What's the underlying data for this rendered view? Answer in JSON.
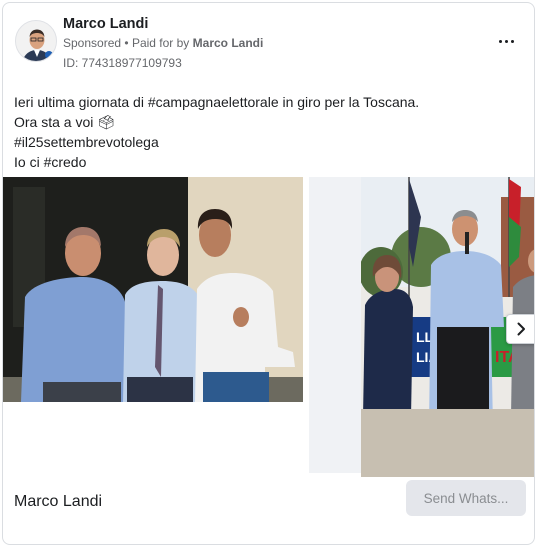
{
  "header": {
    "page_name": "Marco Landi",
    "sponsored_label": "Sponsored",
    "separator": "•",
    "paid_for_prefix": "Paid for by",
    "paid_for_name": "Marco Landi",
    "ad_id": "ID: 774318977109793",
    "more_icon": "more-options-icon"
  },
  "post": {
    "lines": [
      "Ieri ultima giornata di #campagnaelettorale in giro per la Toscana.",
      "Ora sta a voi 🗳",
      "#il25settembrevotolega",
      "Io ci #credo"
    ]
  },
  "carousel": {
    "next_icon": "chevron-right-icon"
  },
  "footer": {
    "cta_title": "Marco Landi",
    "cta_button": "Send Whats..."
  }
}
